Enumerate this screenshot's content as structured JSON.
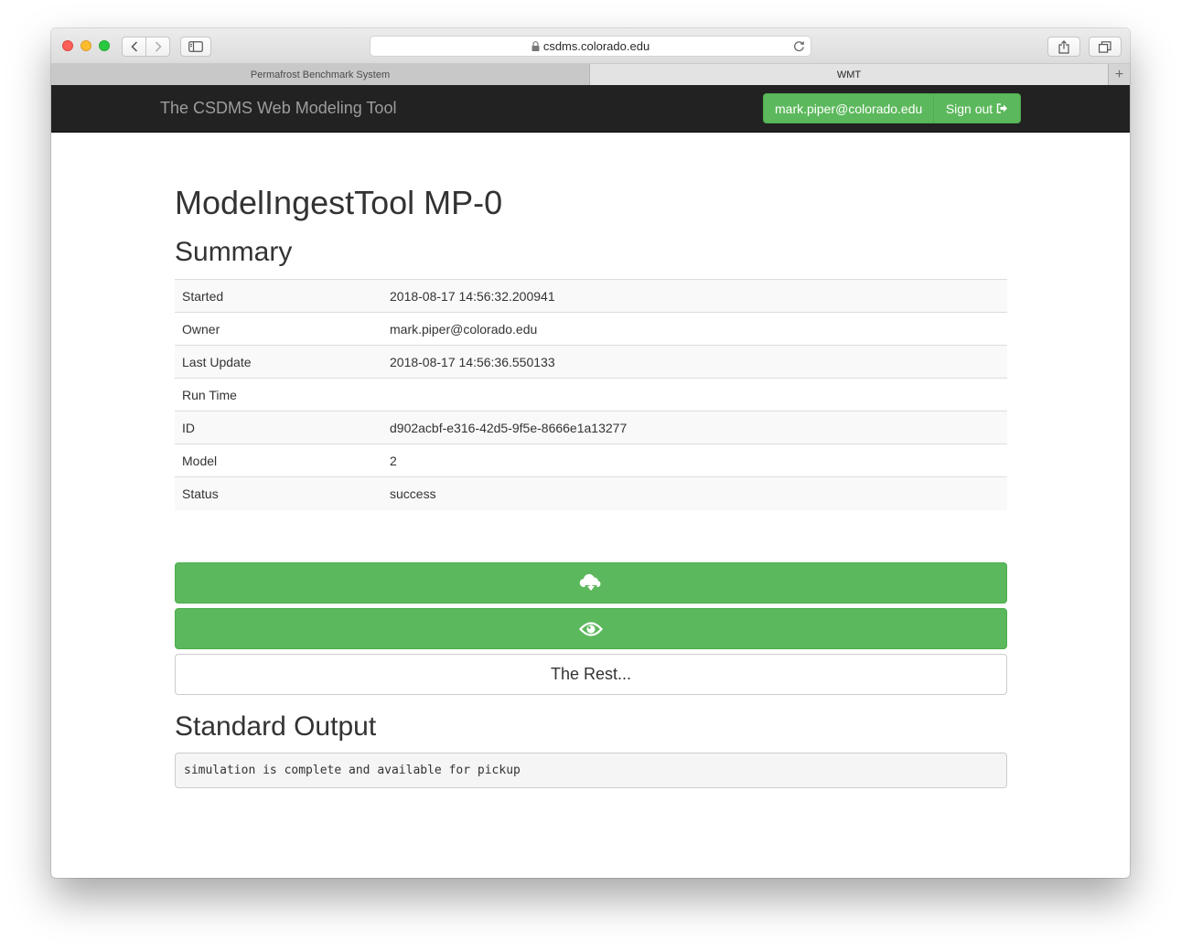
{
  "browser": {
    "address": "csdms.colorado.edu",
    "tabs": [
      {
        "label": "Permafrost Benchmark System",
        "active": false
      },
      {
        "label": "WMT",
        "active": true
      }
    ],
    "new_tab": "+"
  },
  "navbar": {
    "brand": "The CSDMS Web Modeling Tool",
    "user": "mark.piper@colorado.edu",
    "signout": "Sign out"
  },
  "page": {
    "title": "ModelIngestTool MP-0",
    "summary_heading": "Summary",
    "summary": [
      {
        "label": "Started",
        "value": "2018-08-17 14:56:32.200941"
      },
      {
        "label": "Owner",
        "value": "mark.piper@colorado.edu"
      },
      {
        "label": "Last Update",
        "value": "2018-08-17 14:56:36.550133"
      },
      {
        "label": "Run Time",
        "value": ""
      },
      {
        "label": "ID",
        "value": "d902acbf-e316-42d5-9f5e-8666e1a13277"
      },
      {
        "label": "Model",
        "value": "2"
      },
      {
        "label": "Status",
        "value": "success"
      }
    ],
    "actions": {
      "download_icon": "cloud-download-icon",
      "view_icon": "eye-icon",
      "rest_label": "The Rest..."
    },
    "output_heading": "Standard Output",
    "stdout": "simulation is complete and available for pickup"
  },
  "colors": {
    "success": "#5cb85c",
    "navbar": "#222222"
  }
}
